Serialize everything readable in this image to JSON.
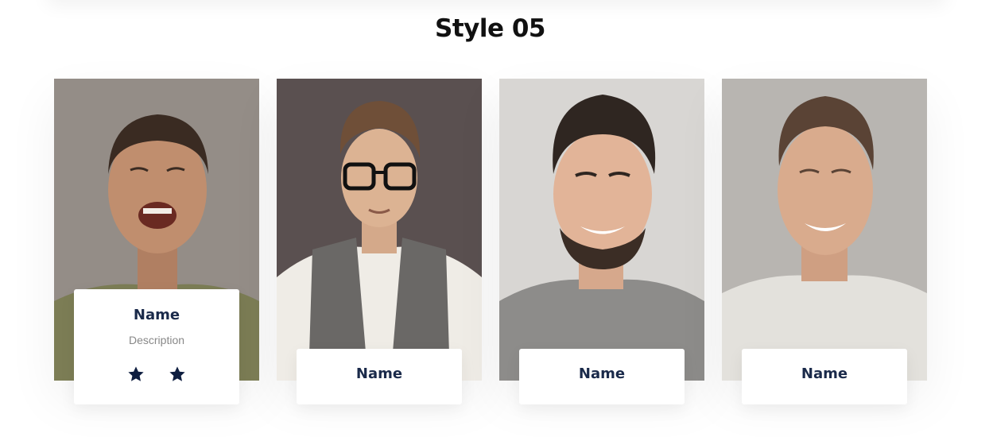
{
  "page": {
    "title": "Style 05"
  },
  "colors": {
    "name_text": "#1a2a4a",
    "description_text": "#888888",
    "star": "#0e1e40"
  },
  "cards": [
    {
      "name": "Name",
      "description": "Description",
      "rating_stars_visible": 2,
      "photo": "man-laughing-photo"
    },
    {
      "name": "Name",
      "photo": "man-with-glasses-photo"
    },
    {
      "name": "Name",
      "photo": "bearded-man-smiling-photo"
    },
    {
      "name": "Name",
      "photo": "man-smiling-photo"
    }
  ]
}
